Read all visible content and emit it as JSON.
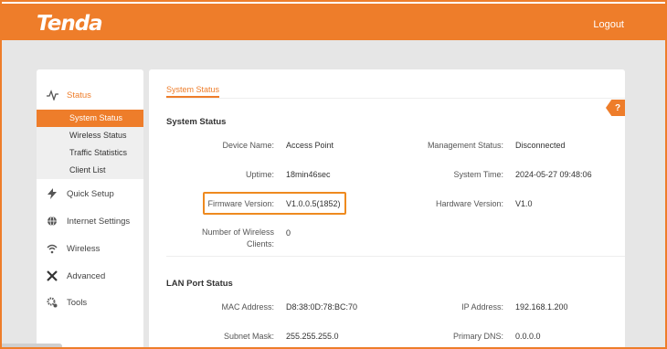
{
  "header": {
    "logo": "Tenda",
    "logout": "Logout"
  },
  "sidebar": {
    "items": [
      {
        "label": "Status",
        "icon": "pulse-icon"
      },
      {
        "label": "Quick Setup",
        "icon": "bolt-icon"
      },
      {
        "label": "Internet Settings",
        "icon": "globe-icon"
      },
      {
        "label": "Wireless",
        "icon": "wifi-icon"
      },
      {
        "label": "Advanced",
        "icon": "tools-cross-icon"
      },
      {
        "label": "Tools",
        "icon": "gears-icon"
      }
    ],
    "sub_items": [
      "System Status",
      "Wireless Status",
      "Traffic Statistics",
      "Client List"
    ]
  },
  "main": {
    "tab": "System Status",
    "help": "?",
    "system_status": {
      "title": "System Status",
      "device_name_label": "Device Name:",
      "device_name": "Access Point",
      "management_status_label": "Management Status:",
      "management_status": "Disconnected",
      "uptime_label": "Uptime:",
      "uptime": "18min46sec",
      "system_time_label": "System Time:",
      "system_time": "2024-05-27 09:48:06",
      "firmware_label": "Firmware Version:",
      "firmware": "V1.0.0.5(1852)",
      "hardware_label": "Hardware Version:",
      "hardware": "V1.0",
      "clients_label_1": "Number of Wireless",
      "clients_label_2": "Clients:",
      "clients": "0"
    },
    "lan_status": {
      "title": "LAN Port Status",
      "mac_label": "MAC Address:",
      "mac": "D8:38:0D:78:BC:70",
      "ip_label": "IP Address:",
      "ip": "192.168.1.200",
      "subnet_label": "Subnet Mask:",
      "subnet": "255.255.255.0",
      "dns_label": "Primary DNS:",
      "dns": "0.0.0.0"
    }
  },
  "colors": {
    "accent": "#ee7d2a",
    "background": "#e6e6e6"
  }
}
